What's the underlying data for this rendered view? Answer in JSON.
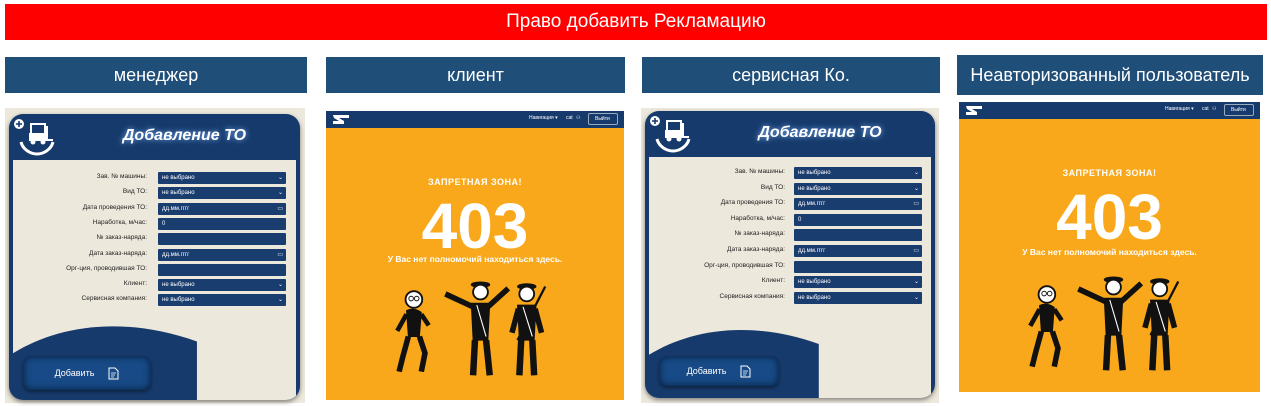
{
  "banner": "Право добавить Рекламацию",
  "columns": [
    "менеджер",
    "клиент",
    "сервисная Ко.",
    "Неавторизованный пользователь"
  ],
  "form": {
    "title": "Добавление ТО",
    "fields": [
      {
        "label": "Зав. № машины:",
        "value": "не выбрано",
        "type": "select"
      },
      {
        "label": "Вид ТО:",
        "value": "не выбрано",
        "type": "select"
      },
      {
        "label": "Дата проведения ТО:",
        "value": "дд.мм.гггг",
        "type": "date"
      },
      {
        "label": "Наработка, м/час:",
        "value": "0",
        "type": "input"
      },
      {
        "label": "№ заказ-наряда:",
        "value": "",
        "type": "input"
      },
      {
        "label": "Дата заказ-наряда:",
        "value": "дд.мм.гггг",
        "type": "date"
      },
      {
        "label": "Орг-ция, проводившая ТО:",
        "value": "",
        "type": "input"
      },
      {
        "label": "Клиент:",
        "value": "не выбрано",
        "type": "select"
      },
      {
        "label": "Сервисная компания:",
        "value": "не выбрано",
        "type": "select"
      }
    ],
    "add_label": "Добавить"
  },
  "error": {
    "zone": "ЗАПРЕТНАЯ ЗОНА!",
    "code": "403",
    "message": "У Вас нет полномочий находиться здесь.",
    "nav_label": "Навигация",
    "user_short": "cat",
    "logout_label": "Выйти"
  },
  "colors": {
    "banner": "#ff0000",
    "header": "#1f4e79",
    "navy": "#163a6b",
    "orange": "#f9a81b",
    "cream": "#ede8dc"
  }
}
